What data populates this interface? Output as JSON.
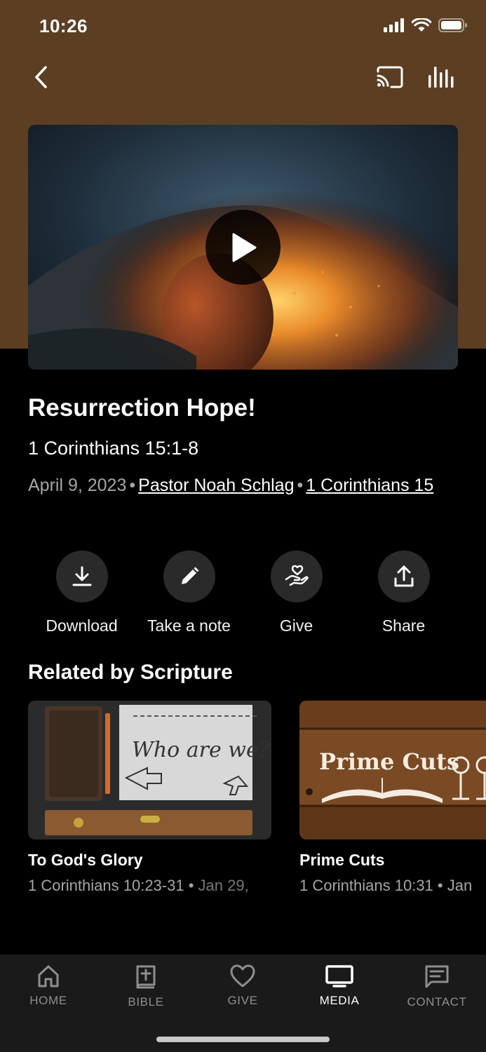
{
  "status_bar": {
    "time": "10:26"
  },
  "episode": {
    "title": "Resurrection Hope!",
    "passage": "1 Corinthians 15:1-8",
    "date": "April 9, 2023",
    "separator": "•",
    "speaker": "Pastor Noah Schlag",
    "series": "1 Corinthians 15"
  },
  "actions": [
    {
      "label": "Download",
      "icon": "download-icon"
    },
    {
      "label": "Take a note",
      "icon": "pencil-icon"
    },
    {
      "label": "Give",
      "icon": "give-hand-icon"
    },
    {
      "label": "Share",
      "icon": "share-icon"
    }
  ],
  "related": {
    "heading": "Related by Scripture",
    "items": [
      {
        "title": "To God's Glory",
        "passage": "1 Corinthians 10:23-31",
        "date": "Jan 29,",
        "thumb_text": "Who are we?"
      },
      {
        "title": "Prime Cuts",
        "passage": "1 Corinthians 10:31",
        "date": "Jan",
        "thumb_text": "Prime Cuts"
      }
    ]
  },
  "tabs": [
    {
      "label": "HOME",
      "icon": "home-icon",
      "active": false
    },
    {
      "label": "BIBLE",
      "icon": "bible-icon",
      "active": false
    },
    {
      "label": "GIVE",
      "icon": "heart-icon",
      "active": false
    },
    {
      "label": "MEDIA",
      "icon": "tv-icon",
      "active": true
    },
    {
      "label": "CONTACT",
      "icon": "message-icon",
      "active": false
    }
  ],
  "colors": {
    "header_brown": "#5c3e22",
    "background": "#000000",
    "muted_text": "#a6a6a6",
    "tabbar": "#1a1a1a"
  }
}
